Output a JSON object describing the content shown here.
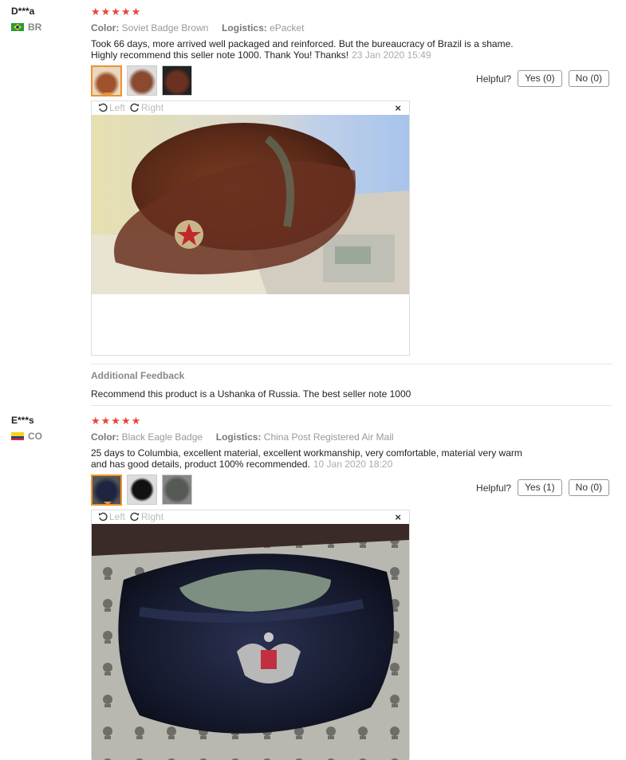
{
  "reviews": [
    {
      "user": "D***a",
      "country": "BR",
      "stars": "★★★★★",
      "color_label": "Color:",
      "color_value": "Soviet Badge Brown",
      "logistics_label": "Logistics:",
      "logistics_value": "ePacket",
      "text_line1": "Took 66 days, more arrived well packaged and reinforced. But the bureaucracy of Brazil is a shame.",
      "text_line2": "Highly recommend this seller note 1000. Thank You! Thanks!",
      "date": "23 Jan 2020 15:49",
      "helpful_label": "Helpful?",
      "yes_label": "Yes (0)",
      "no_label": "No (0)",
      "rotate_left": "Left",
      "rotate_right": "Right",
      "close": "×",
      "additional_title": "Additional Feedback",
      "additional_text": "Recommend this product is a Ushanka of Russia. The best seller note 1000"
    },
    {
      "user": "E***s",
      "country": "CO",
      "stars": "★★★★★",
      "color_label": "Color:",
      "color_value": "Black Eagle Badge",
      "logistics_label": "Logistics:",
      "logistics_value": "China Post Registered Air Mail",
      "text_line1": "25 days to Columbia, excellent material, excellent workmanship, very comfortable, material very warm",
      "text_line2": "and has good details, product 100% recommended.",
      "date": "10 Jan 2020 18:20",
      "helpful_label": "Helpful?",
      "yes_label": "Yes (1)",
      "no_label": "No (0)",
      "rotate_left": "Left",
      "rotate_right": "Right",
      "close": "×"
    }
  ],
  "colors": {
    "star": "#e8443a",
    "active_thumb_border": "#f0912e",
    "meta_text": "#999999"
  },
  "icons": [
    "rotate-left-icon",
    "rotate-right-icon",
    "close-icon",
    "flag-br-icon",
    "flag-co-icon"
  ]
}
